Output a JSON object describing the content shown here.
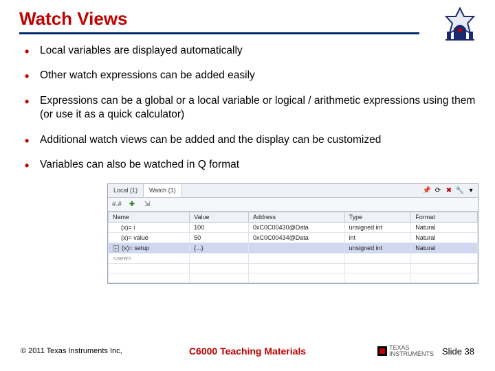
{
  "title": "Watch Views",
  "bullets": [
    "Local variables are displayed automatically",
    "Other watch expressions can be added easily",
    "Expressions can be a global or a local variable or logical / arithmetic expressions using them (or use it as a quick calculator)",
    "Additional watch views can be added and the display can be customized",
    "Variables can also be watched in Q format"
  ],
  "ide": {
    "tabs": [
      "Local (1)",
      "Watch (1)"
    ],
    "headers": [
      "Name",
      "Value",
      "Address",
      "Type",
      "Format"
    ],
    "rows": [
      {
        "name": "i",
        "value": "100",
        "address": "0xC0C00430@Data",
        "type": "unsigned int",
        "format": "Natural"
      },
      {
        "name": "value",
        "value": "50",
        "address": "0xC0C00434@Data",
        "type": "int",
        "format": "Natural"
      },
      {
        "name": "setup",
        "value": "{...}",
        "address": "",
        "type": "unsigned int",
        "format": "Natural",
        "expandable": true
      },
      {
        "name": "<new>",
        "value": "",
        "address": "",
        "type": "",
        "format": "",
        "new": true
      }
    ]
  },
  "footer": {
    "copyright": "© 2011 Texas Instruments Inc,",
    "course": "C6000 Teaching Materials",
    "brand1": "TEXAS",
    "brand2": "INSTRUMENTS",
    "slide": "Slide 38"
  }
}
